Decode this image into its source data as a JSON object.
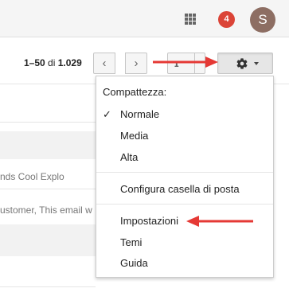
{
  "header": {
    "apps_icon": "apps-grid-icon",
    "notification_count": "4",
    "avatar_initial": "S",
    "badge_color": "#db4437",
    "avatar_color": "#8d6e63"
  },
  "toolbar": {
    "range": "1–50",
    "of_word": "di",
    "total": "1.029",
    "prev_icon": "‹",
    "next_icon": "›",
    "input_tools_glyph": "ɪ",
    "settings_icon": "gear-icon"
  },
  "list": {
    "snippets": [
      "nds Cool Explo",
      "ustomer, This email w"
    ]
  },
  "settings_menu": {
    "density_header": "Compattezza:",
    "density_options": [
      "Normale",
      "Media",
      "Alta"
    ],
    "selected_density": "Normale",
    "configure_inbox": "Configura casella di posta",
    "settings": "Impostazioni",
    "themes": "Temi",
    "help": "Guida"
  },
  "annotations": {
    "arrow_color": "#e53935"
  }
}
